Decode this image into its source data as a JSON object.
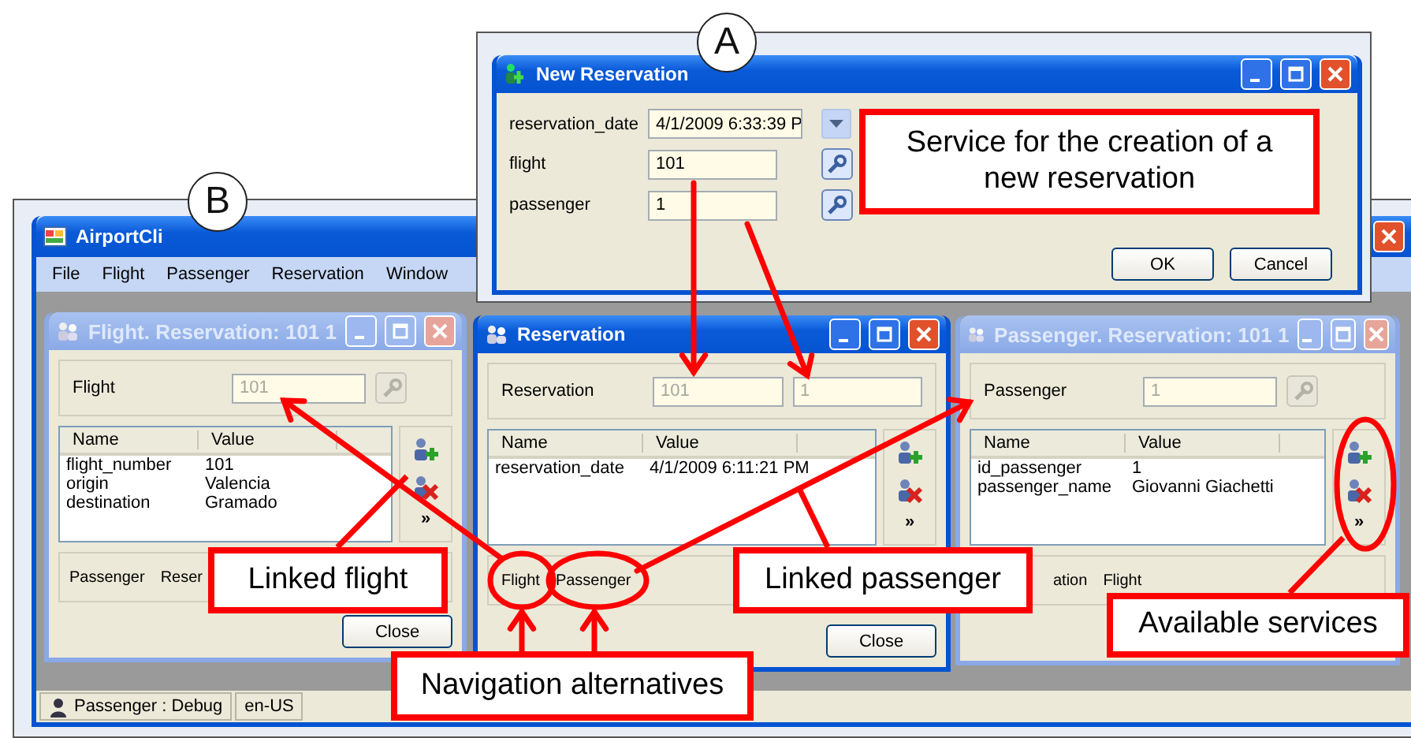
{
  "dialog": {
    "marker": "A",
    "title": "New Reservation",
    "fields": [
      {
        "label": "reservation_date",
        "value": "4/1/2009 6:33:39 P",
        "kind": "dropdown"
      },
      {
        "label": "flight",
        "value": "101",
        "kind": "lookup"
      },
      {
        "label": "passenger",
        "value": "1",
        "kind": "lookup"
      }
    ],
    "buttons": [
      "OK",
      "Cancel"
    ]
  },
  "main_window": {
    "marker": "B",
    "title": "AirportCli",
    "menu": [
      "File",
      "Flight",
      "Passenger",
      "Reservation",
      "Window"
    ],
    "status_bar": [
      "Passenger : Debug",
      "en-US"
    ]
  },
  "child_windows": [
    {
      "title": "Flight. Reservation: 101 1",
      "active": false,
      "group_label": "Flight",
      "fields": [
        "101"
      ],
      "lookup": true,
      "columns": [
        "Name",
        "Value"
      ],
      "rows": [
        {
          "name": "flight_number",
          "value": "101"
        },
        {
          "name": "origin",
          "value": "Valencia"
        },
        {
          "name": "destination",
          "value": "Gramado"
        }
      ],
      "more": "»",
      "navigation": [
        "Passenger",
        "Reser"
      ],
      "close": "Close"
    },
    {
      "title": "Reservation",
      "active": true,
      "group_label": "Reservation",
      "fields": [
        "101",
        "1"
      ],
      "lookup": false,
      "columns": [
        "Name",
        "Value"
      ],
      "rows": [
        {
          "name": "reservation_date",
          "value": "4/1/2009 6:11:21 PM"
        }
      ],
      "more": "»",
      "navigation": [
        "Flight",
        "Passenger"
      ],
      "close": "Close"
    },
    {
      "title": "Passenger. Reservation: 101 1",
      "active": false,
      "group_label": "Passenger",
      "fields": [
        "1"
      ],
      "lookup": true,
      "columns": [
        "Name",
        "Value"
      ],
      "rows": [
        {
          "name": "id_passenger",
          "value": "1"
        },
        {
          "name": "passenger_name",
          "value": "Giovanni Giachetti"
        }
      ],
      "more": "»",
      "navigation": [
        "ation",
        "Flight"
      ]
    }
  ],
  "callouts": [
    {
      "text": "Service for the creation of a new reservation"
    },
    {
      "text": "Linked flight"
    },
    {
      "text": "Linked passenger"
    },
    {
      "text": "Navigation alternatives"
    },
    {
      "text": "Available services"
    }
  ]
}
